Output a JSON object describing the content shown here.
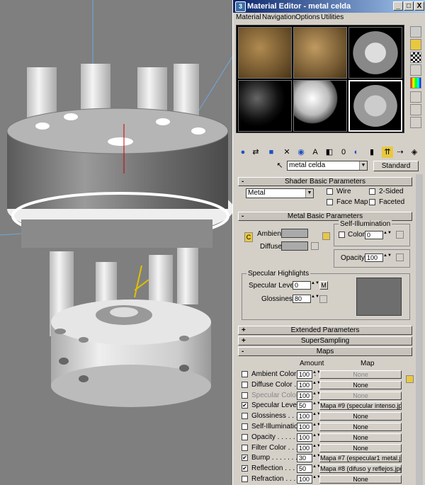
{
  "window": {
    "title": "Material Editor - metal celda"
  },
  "title_buttons": {
    "minimize": "_",
    "maximize": "□",
    "close": "X"
  },
  "menu": [
    "Material",
    "Navigation",
    "Options",
    "Utilities"
  ],
  "material_name": "metal celda",
  "standard_button": "Standard",
  "rollouts": {
    "shader": "Shader Basic Parameters",
    "metal": "Metal Basic Parameters",
    "extended": "Extended Parameters",
    "supersampling": "SuperSampling",
    "maps": "Maps"
  },
  "rollout_signs": {
    "open": "-",
    "closed": "+"
  },
  "shader": {
    "type": "Metal",
    "wire": "Wire",
    "two_sided": "2-Sided",
    "face_map": "Face Map",
    "faceted": "Faceted"
  },
  "metal": {
    "ambient": "Ambient:",
    "diffuse": "Diffuse:",
    "lock_letter": "C",
    "self_illum_title": "Self-Illumination",
    "color_label": "Color",
    "color_value": "0",
    "opacity_label": "Opacity:",
    "opacity_value": "100"
  },
  "specular": {
    "title": "Specular Highlights",
    "level_label": "Specular Level:",
    "level_value": "0",
    "m_button": "M",
    "gloss_label": "Glossiness:",
    "gloss_value": "80"
  },
  "maps": {
    "amount_header": "Amount",
    "map_header": "Map",
    "rows": [
      {
        "label": "Ambient Color . . . . .",
        "checked": false,
        "amount": "100",
        "map": "None",
        "dim": false,
        "map_dim": true
      },
      {
        "label": "Diffuse Color . . . . .",
        "checked": false,
        "amount": "100",
        "map": "None",
        "dim": false,
        "map_dim": false
      },
      {
        "label": "Specular Color . . . .",
        "checked": false,
        "amount": "100",
        "map": "None",
        "dim": true,
        "map_dim": true
      },
      {
        "label": "Specular Level . .",
        "checked": true,
        "amount": "50",
        "map": "Mapa #9 (specular intenso.jpg)",
        "dim": false,
        "map_dim": false
      },
      {
        "label": "Glossiness . . . . . .",
        "checked": false,
        "amount": "100",
        "map": "None",
        "dim": false,
        "map_dim": false
      },
      {
        "label": "Self-Illumination . .",
        "checked": false,
        "amount": "100",
        "map": "None",
        "dim": false,
        "map_dim": false
      },
      {
        "label": "Opacity . . . . . . . .",
        "checked": false,
        "amount": "100",
        "map": "None",
        "dim": false,
        "map_dim": false
      },
      {
        "label": "Filter Color . . . . .",
        "checked": false,
        "amount": "100",
        "map": "None",
        "dim": false,
        "map_dim": false
      },
      {
        "label": "Bump . . . . . . . .",
        "checked": true,
        "amount": "30",
        "map": "Mapa #7 (especular1 metal.jpg)",
        "dim": false,
        "map_dim": false
      },
      {
        "label": "Reflection . . . . .",
        "checked": true,
        "amount": "50",
        "map": "Mapa #8 (difuso y reflejos.jpg)",
        "dim": false,
        "map_dim": false
      },
      {
        "label": "Refraction . . . . .",
        "checked": false,
        "amount": "100",
        "map": "None",
        "dim": false,
        "map_dim": false
      }
    ]
  },
  "icons": {
    "check_mark": "✔",
    "spinner": "▲▼",
    "dropdown": "▼"
  },
  "colors": {
    "title_start": "#0a246a",
    "title_end": "#a6caf0",
    "panel": "#d4d0c8",
    "viewport": "#7f7f7f"
  }
}
